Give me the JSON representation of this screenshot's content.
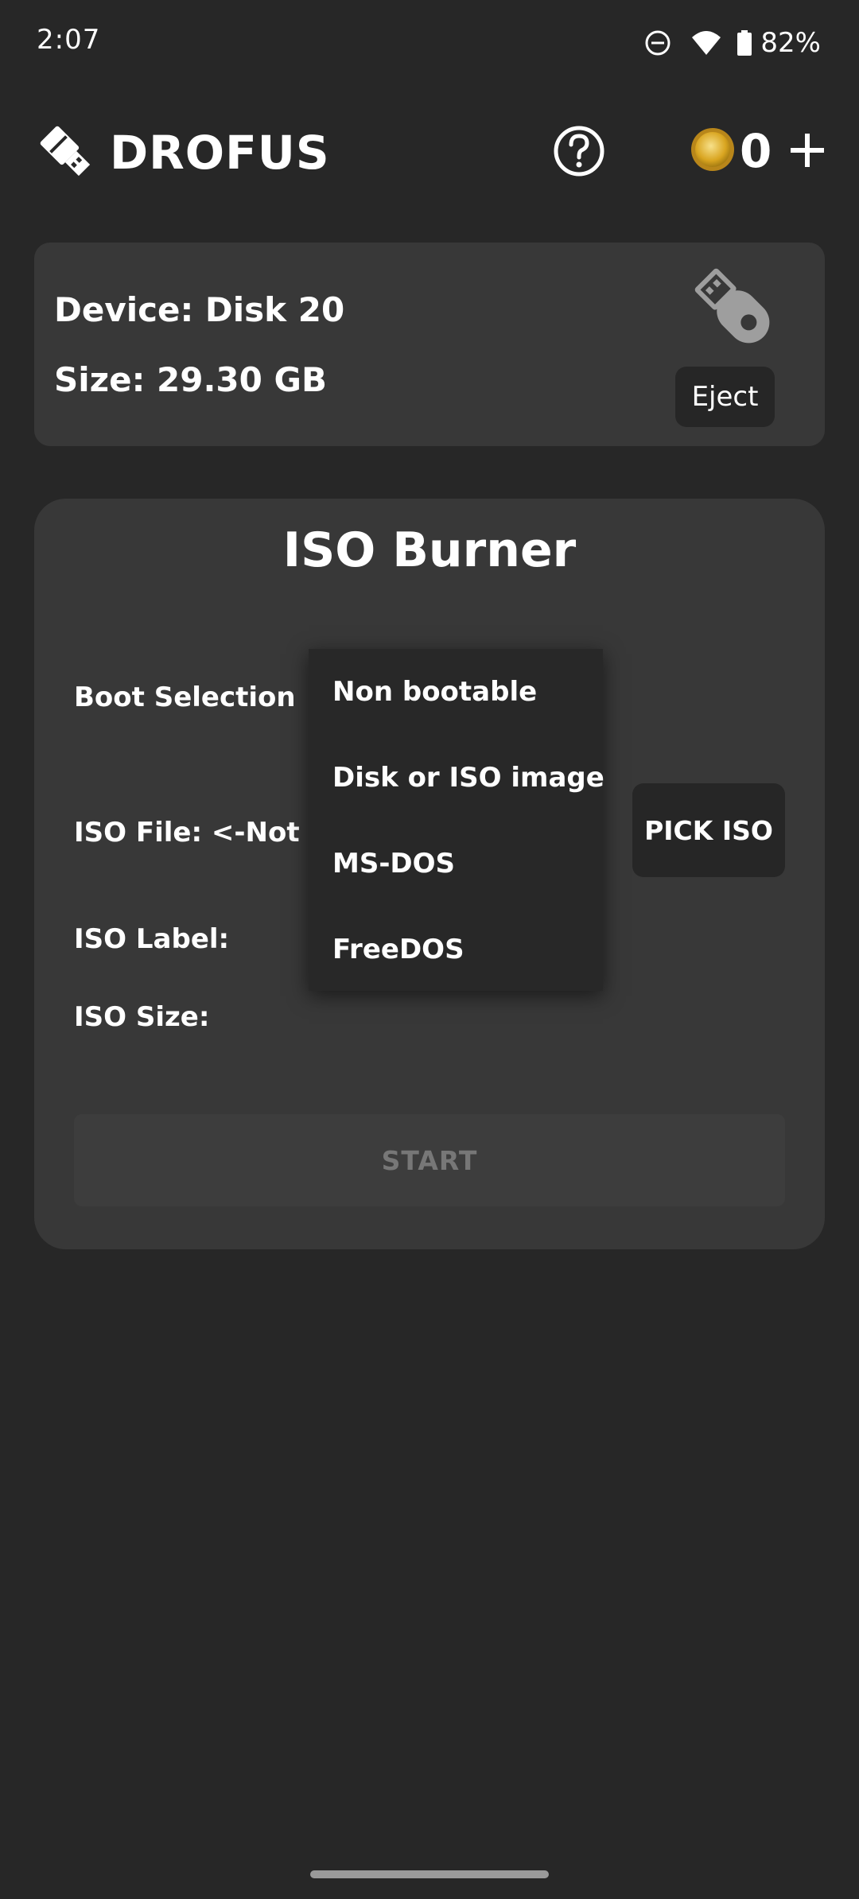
{
  "status_bar": {
    "time": "2:07",
    "battery": "82%",
    "icons": [
      "do-not-disturb-icon",
      "wifi-icon",
      "battery-icon"
    ]
  },
  "header": {
    "app_title": "DROFUS",
    "coins": "0",
    "icons": [
      "usb-drive-icon",
      "help-icon",
      "coin-icon",
      "plus-icon"
    ]
  },
  "device": {
    "device_line": "Device: Disk 20",
    "size_line": "Size: 29.30 GB",
    "eject_label": "Eject"
  },
  "burner": {
    "title": "ISO Burner",
    "boot_selection_label": "Boot Selection",
    "iso_file_label": "ISO File:  <-Not Se",
    "iso_label_label": "ISO Label:",
    "iso_size_label": "ISO Size:",
    "pick_iso_label": "PICK ISO",
    "start_label": "START"
  },
  "boot_menu": {
    "items": [
      "Non bootable",
      "Disk or ISO image",
      "MS-DOS",
      "FreeDOS"
    ]
  },
  "colors": {
    "background": "#272727",
    "card": "#383838",
    "button": "#262626",
    "coin": "#d9a520",
    "usb_icon": "#9e9e9e",
    "disabled_text": "#777777"
  }
}
